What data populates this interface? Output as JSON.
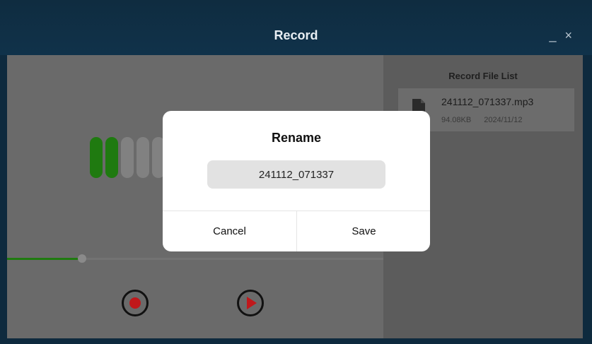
{
  "window": {
    "title": "Record",
    "minimize_label": "_",
    "close_label": "×"
  },
  "recorder": {
    "level_meter": {
      "active_bars": 2,
      "total_bars": 5
    },
    "progress_fraction": 0.2,
    "record_button_icon": "record-icon",
    "play_button_icon": "play-icon"
  },
  "file_list": {
    "title": "Record File List",
    "items": [
      {
        "name": "241112_071337.mp3",
        "size": "94.08KB",
        "date": "2024/11/12",
        "icon": "file-icon"
      }
    ]
  },
  "rename_dialog": {
    "title": "Rename",
    "input_value": "241112_071337",
    "cancel_label": "Cancel",
    "save_label": "Save"
  },
  "colors": {
    "titlebar": "#0f2c40",
    "accent_green": "#1f7a10",
    "record_red": "#c0181b",
    "overlay_gray": "#5f5f5f"
  }
}
